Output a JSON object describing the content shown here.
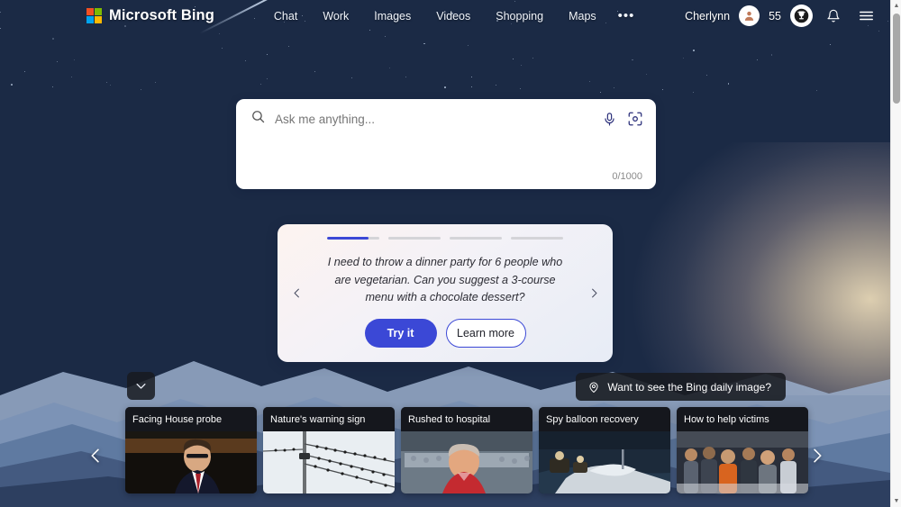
{
  "header": {
    "brand": "Microsoft Bing",
    "logo_icon": "microsoft-logo-icon",
    "logo_colors": [
      "#f25022",
      "#7fba00",
      "#00a4ef",
      "#ffb900"
    ],
    "nav": [
      {
        "label": "Chat",
        "name": "nav-chat"
      },
      {
        "label": "Work",
        "name": "nav-work"
      },
      {
        "label": "Images",
        "name": "nav-images"
      },
      {
        "label": "Videos",
        "name": "nav-videos"
      },
      {
        "label": "Shopping",
        "name": "nav-shopping"
      },
      {
        "label": "Maps",
        "name": "nav-maps"
      }
    ],
    "more_label": "•••",
    "user_name": "Cherlynn",
    "avatar_icon": "user-avatar-icon",
    "rewards_points": "55",
    "rewards_icon": "trophy-icon",
    "notifications_icon": "bell-icon",
    "menu_icon": "hamburger-menu-icon"
  },
  "search": {
    "placeholder": "Ask me anything...",
    "value": "",
    "search_icon": "search-icon",
    "mic_icon": "microphone-icon",
    "camera_icon": "visual-search-icon",
    "counter": "0/1000"
  },
  "suggestion_card": {
    "prompt": "I need to throw a dinner party for 6 people who are vegetarian. Can you suggest a 3-course menu with a chocolate dessert?",
    "try_label": "Try it",
    "learn_label": "Learn more",
    "prev_icon": "chevron-left-icon",
    "next_icon": "chevron-right-icon",
    "pips": [
      80,
      0,
      0,
      0
    ],
    "accent_color": "#3b48d6"
  },
  "daily_image_pill": {
    "label": "Want to see the Bing daily image?",
    "icon": "location-pin-icon"
  },
  "expand_button": {
    "icon": "chevron-down-icon"
  },
  "news": {
    "prev_icon": "chevron-left-icon",
    "next_icon": "chevron-right-icon",
    "cards": [
      {
        "title": "Facing House probe"
      },
      {
        "title": "Nature's warning sign"
      },
      {
        "title": "Rushed to hospital"
      },
      {
        "title": "Spy balloon recovery"
      },
      {
        "title": "How to help victims"
      }
    ]
  },
  "scrollbar": {
    "up_icon": "scroll-up-arrow-icon",
    "down_icon": "scroll-down-arrow-icon"
  }
}
